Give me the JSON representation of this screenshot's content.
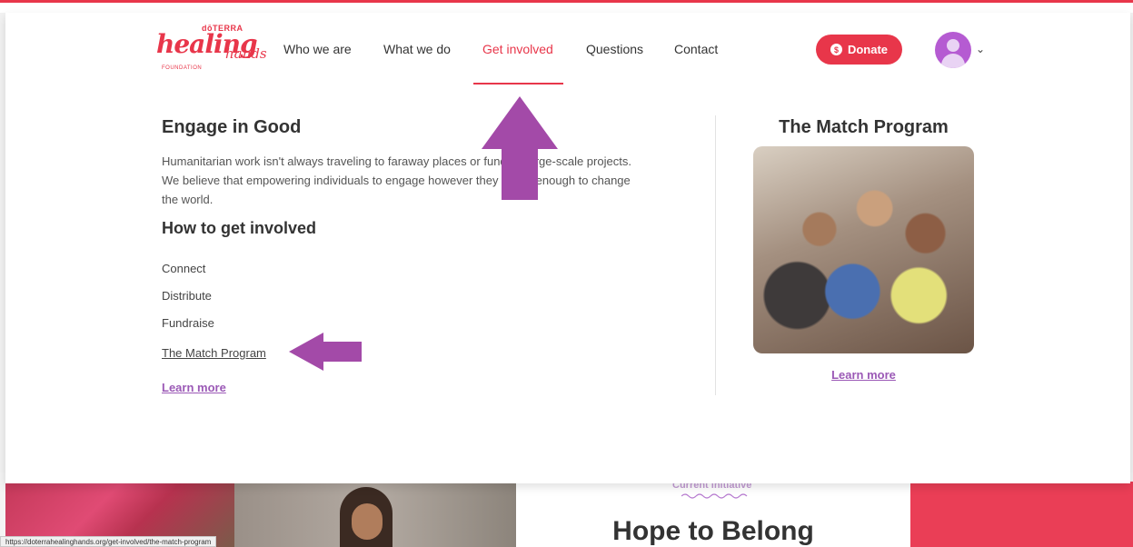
{
  "logo": {
    "brand_top": "dōTERRA",
    "brand_main": "healing",
    "brand_small": "hands",
    "brand_sub": "FOUNDATION"
  },
  "nav": {
    "items": [
      {
        "label": "Who we are"
      },
      {
        "label": "What we do"
      },
      {
        "label": "Get involved",
        "active": true
      },
      {
        "label": "Questions"
      },
      {
        "label": "Contact"
      }
    ],
    "donate_label": "Donate",
    "donate_icon": "$"
  },
  "engage": {
    "title": "Engage in Good",
    "body": "Humanitarian work isn't always traveling to faraway places or funding large-scale projects. We believe that empowering individuals to engage however they can is enough to change the world.",
    "how_title": "How to get involved",
    "links": [
      "Connect",
      "Distribute",
      "Fundraise",
      "The Match Program"
    ],
    "learn_more": "Learn more"
  },
  "match": {
    "title": "The Match Program",
    "learn_more": "Learn more"
  },
  "below": {
    "current_label": "Current initiative",
    "hope_title": "Hope to Belong"
  },
  "status_url": "https://doterrahealinghands.org/get-involved/the-match-program",
  "colors": {
    "brand_red": "#e8364a",
    "accent_purple": "#9b59b6",
    "annotation_arrow": "#a34aa8"
  }
}
